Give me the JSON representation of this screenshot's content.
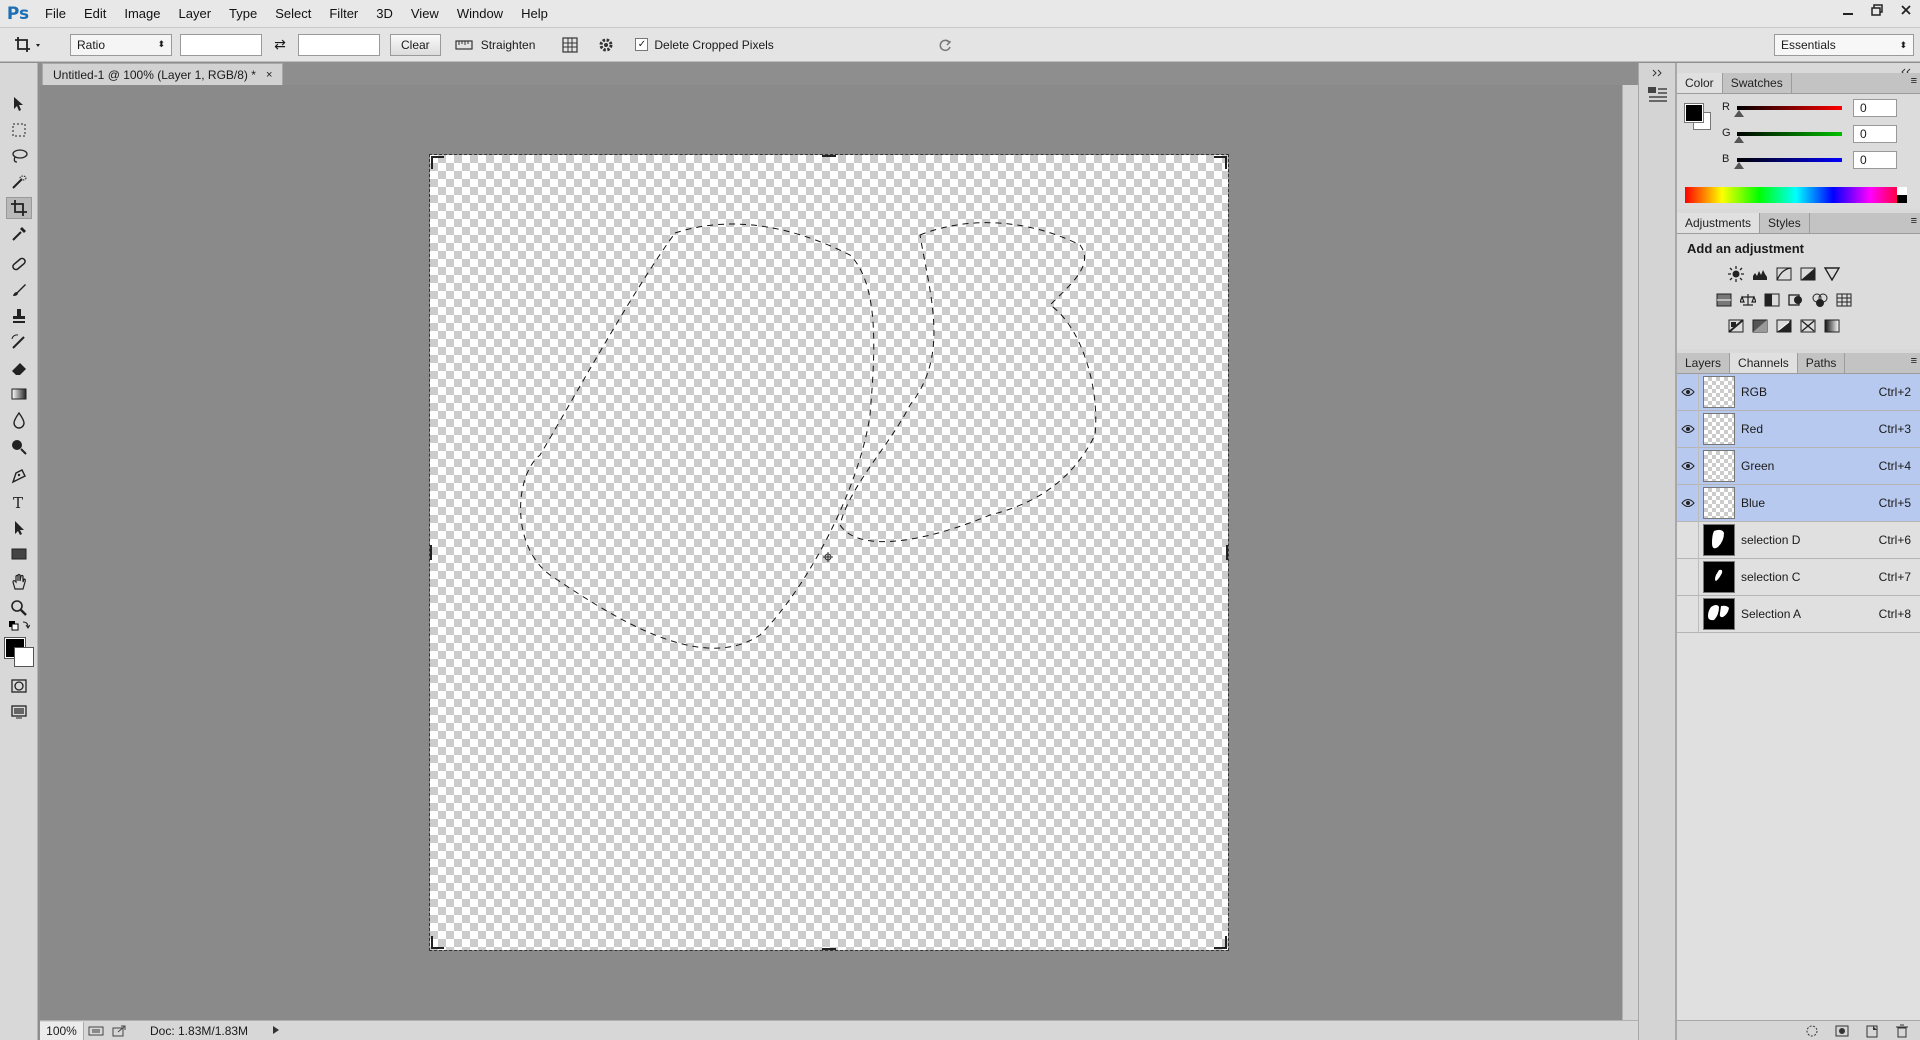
{
  "app": {
    "logo": "Ps"
  },
  "menu": [
    "File",
    "Edit",
    "Image",
    "Layer",
    "Type",
    "Select",
    "Filter",
    "3D",
    "View",
    "Window",
    "Help"
  ],
  "window_controls": [
    "minimize-icon",
    "restore-icon",
    "close-icon"
  ],
  "options": {
    "ratio_label": "Ratio",
    "ratio_width": "",
    "ratio_height": "",
    "clear_label": "Clear",
    "straighten_label": "Straighten",
    "delete_cropped_label": "Delete Cropped Pixels",
    "delete_cropped_checked": true,
    "workspace_label": "Essentials"
  },
  "document": {
    "tab_title": "Untitled-1 @ 100% (Layer 1, RGB/8) *",
    "close_glyph": "×"
  },
  "status": {
    "zoom": "100%",
    "doc_info": "Doc: 1.83M/1.83M"
  },
  "color_panel": {
    "tabs": [
      "Color",
      "Swatches"
    ],
    "active_tab": "Color",
    "channels": [
      {
        "label": "R",
        "value": "0",
        "color": "#ff0000"
      },
      {
        "label": "G",
        "value": "0",
        "color": "#00c000"
      },
      {
        "label": "B",
        "value": "0",
        "color": "#0000ff"
      }
    ],
    "foreground": "#000000",
    "background": "#ffffff"
  },
  "adjustments_panel": {
    "tabs": [
      "Adjustments",
      "Styles"
    ],
    "active_tab": "Adjustments",
    "title": "Add an adjustment",
    "icons": [
      [
        "brightness-contrast-icon",
        "levels-icon",
        "curves-icon",
        "exposure-icon",
        "vibrance-icon"
      ],
      [
        "hue-saturation-icon",
        "color-balance-icon",
        "black-white-icon",
        "photo-filter-icon",
        "channel-mixer-icon",
        "color-lookup-icon"
      ],
      [
        "invert-icon",
        "posterize-icon",
        "threshold-icon",
        "selective-color-icon",
        "gradient-map-icon"
      ]
    ]
  },
  "channels_panel": {
    "tabs": [
      "Layers",
      "Channels",
      "Paths"
    ],
    "active_tab": "Channels",
    "rows": [
      {
        "name": "RGB",
        "shortcut": "Ctrl+2",
        "visible": true,
        "selected": true,
        "thumb": "checker"
      },
      {
        "name": "Red",
        "shortcut": "Ctrl+3",
        "visible": true,
        "selected": true,
        "thumb": "checker"
      },
      {
        "name": "Green",
        "shortcut": "Ctrl+4",
        "visible": true,
        "selected": true,
        "thumb": "checker"
      },
      {
        "name": "Blue",
        "shortcut": "Ctrl+5",
        "visible": true,
        "selected": true,
        "thumb": "checker"
      },
      {
        "name": "selection D",
        "shortcut": "Ctrl+6",
        "visible": false,
        "selected": false,
        "thumb": "mask-d"
      },
      {
        "name": "selection C",
        "shortcut": "Ctrl+7",
        "visible": false,
        "selected": false,
        "thumb": "mask-c"
      },
      {
        "name": "Selection A",
        "shortcut": "Ctrl+8",
        "visible": false,
        "selected": false,
        "thumb": "mask-a"
      }
    ],
    "footer_icons": [
      "load-channel-as-selection-icon",
      "save-selection-as-channel-icon",
      "new-channel-icon",
      "delete-channel-icon"
    ]
  }
}
